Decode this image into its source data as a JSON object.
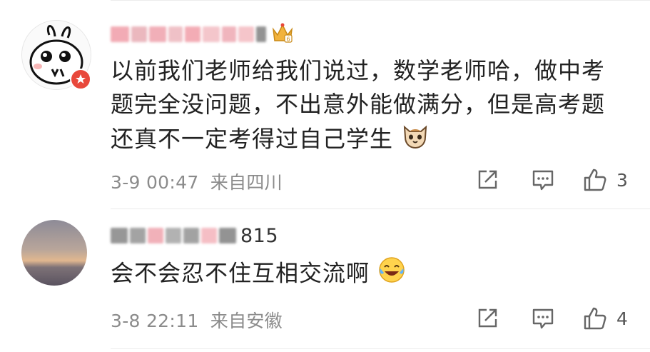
{
  "comments": [
    {
      "name_suffix": "",
      "text": "以前我们老师给我们说过，数学老师哈，做中考题完全没问题，不出意外能做满分，但是高考题还真不一定考得过自己学生",
      "time": "3-9 00:47",
      "location": "来自四川",
      "likes": "3",
      "emoji": "cat-face-icon",
      "badge": "crown-badge-icon"
    },
    {
      "name_suffix": "815",
      "text": "会不会忍不住互相交流啊",
      "time": "3-8 22:11",
      "location": "来自安徽",
      "likes": "4",
      "emoji": "laughing-tears-icon"
    }
  ],
  "colors": {
    "accent": "#e8483b",
    "meta": "#8b8b8b",
    "badge_gold": "#f2b33d"
  }
}
